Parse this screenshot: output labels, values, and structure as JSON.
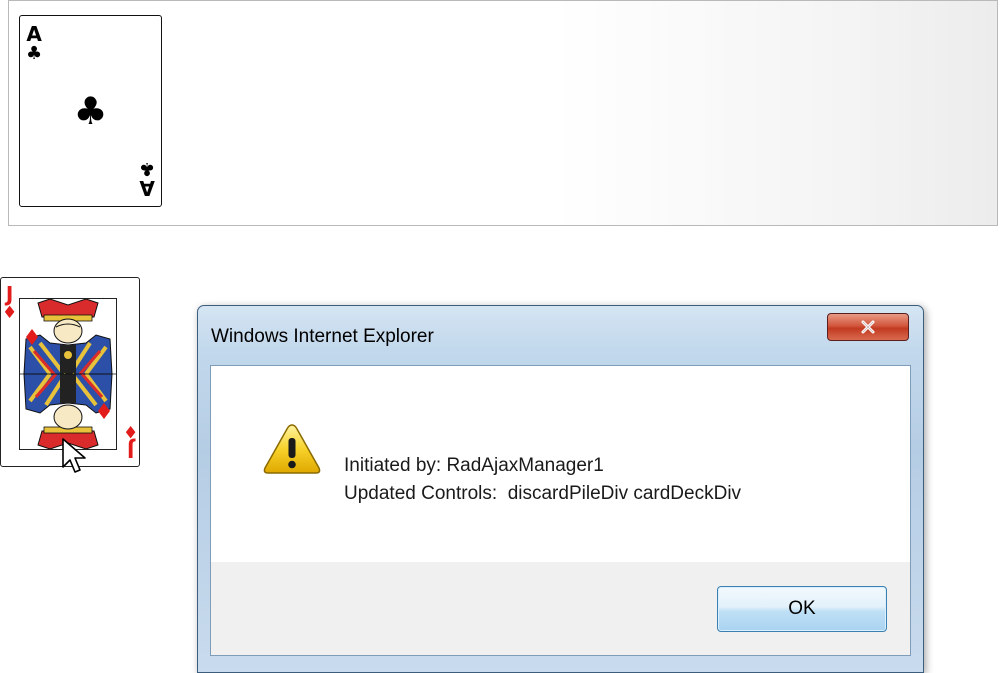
{
  "top_panel": {
    "ace_card": {
      "rank": "A",
      "suit": "♣",
      "color": "#000000"
    }
  },
  "jack_card": {
    "rank": "J",
    "suit": "♦",
    "color": "#e21b1b"
  },
  "dialog": {
    "title": "Windows Internet Explorer",
    "close_icon": "close-icon",
    "icon": "warning-icon",
    "message_lines": [
      "Initiated by: RadAjaxManager1",
      "Updated Controls:  discardPileDiv cardDeckDiv"
    ],
    "ok_label": "OK"
  },
  "colors": {
    "accent_blue": "#3c7fb1",
    "close_red": "#c23a20",
    "warning_yellow": "#f5c400"
  }
}
